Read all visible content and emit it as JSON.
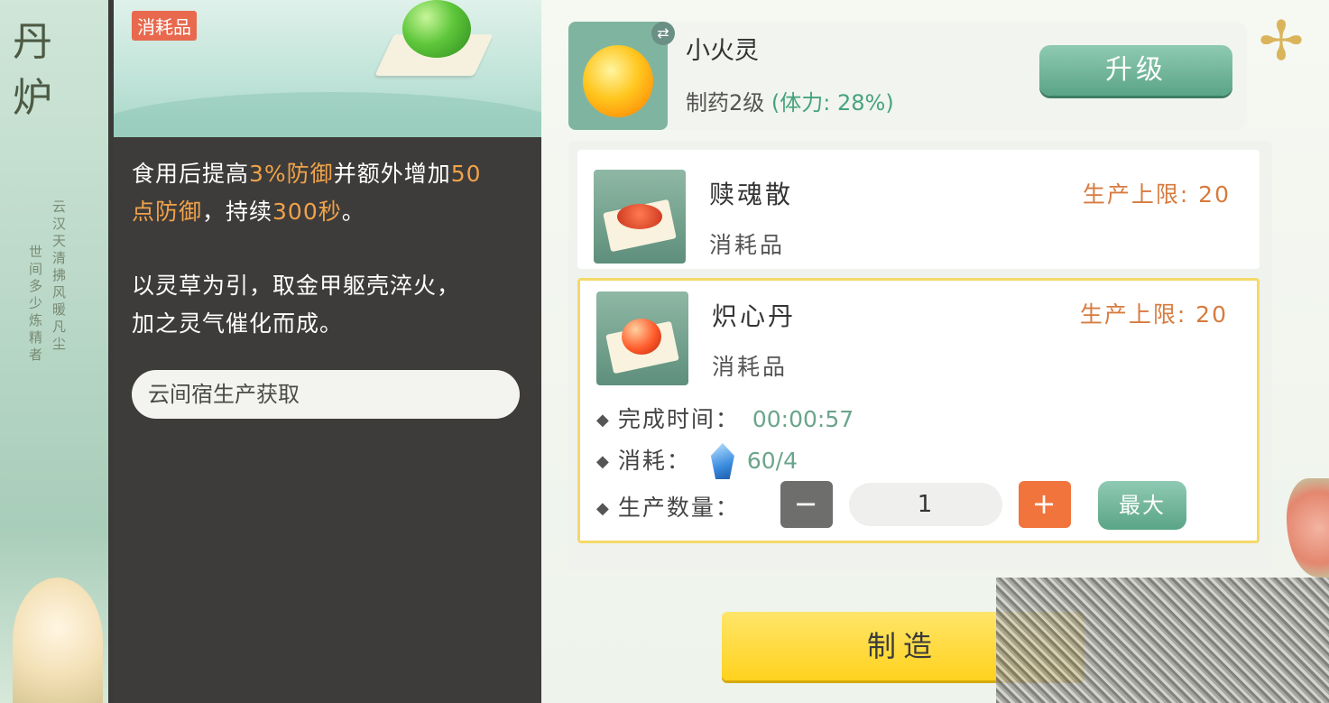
{
  "banner": {
    "title_chars": [
      "丹",
      "炉"
    ],
    "poem_col1": "云汉天清拂风暖凡尘",
    "poem_col2": "世间多少炼精者"
  },
  "item_detail": {
    "category_badge": "消耗品",
    "desc_line1_a": "食用后提高",
    "desc_line1_b": "3%防御",
    "desc_line1_c": "并额外增加",
    "desc_line1_d": "50",
    "desc_line2_a": "点防御",
    "desc_line2_b": "，持续",
    "desc_line2_c": "300秒",
    "desc_line2_d": "。",
    "lore_line1": "以灵草为引，取金甲躯壳淬火，",
    "lore_line2": "加之灵气催化而成。",
    "source": "云间宿生产获取"
  },
  "pet": {
    "name": "小火灵",
    "level_text": "制药2级",
    "stamina_text": "(体力: 28%)",
    "swap_icon": "⇄",
    "upgrade_label": "升级"
  },
  "recipes": [
    {
      "name": "赎魂散",
      "type": "消耗品",
      "limit": "生产上限: 20"
    },
    {
      "name": "炽心丹",
      "type": "消耗品",
      "limit": "生产上限: 20",
      "time_label": "完成时间：",
      "time_value": "00:00:57",
      "cost_label": "消耗：",
      "cost_value": "60/4",
      "qty_label": "生产数量：",
      "qty_value": "1",
      "minus": "−",
      "plus": "+",
      "max_label": "最大"
    }
  ],
  "make_label": "制造",
  "colors": {
    "accent_orange": "#d77b3e",
    "accent_green": "#5aa487",
    "highlight": "#f0a24a",
    "make_yellow": "#ffd21e"
  }
}
